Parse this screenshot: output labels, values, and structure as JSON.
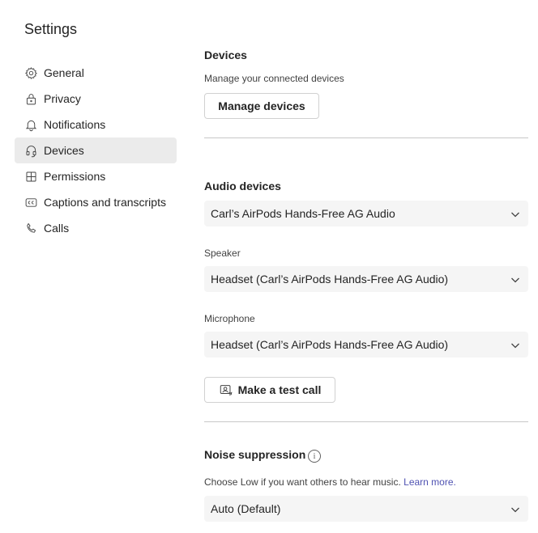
{
  "page": {
    "title": "Settings"
  },
  "sidebar": {
    "items": [
      {
        "label": "General",
        "icon": "gear-icon"
      },
      {
        "label": "Privacy",
        "icon": "lock-icon"
      },
      {
        "label": "Notifications",
        "icon": "bell-icon"
      },
      {
        "label": "Devices",
        "icon": "headset-icon",
        "active": true
      },
      {
        "label": "Permissions",
        "icon": "gift-box-icon"
      },
      {
        "label": "Captions and transcripts",
        "icon": "closed-captions-icon"
      },
      {
        "label": "Calls",
        "icon": "phone-icon"
      }
    ]
  },
  "devices": {
    "heading": "Devices",
    "description": "Manage your connected devices",
    "manage_button": "Manage devices"
  },
  "audio": {
    "heading": "Audio devices",
    "selected_device": "Carl’s AirPods Hands-Free AG Audio",
    "speaker_label": "Speaker",
    "speaker_value": "Headset (Carl’s AirPods Hands-Free AG Audio)",
    "microphone_label": "Microphone",
    "microphone_value": "Headset (Carl’s AirPods Hands-Free AG Audio)",
    "test_call_button": "Make a test call"
  },
  "noise": {
    "heading": "Noise suppression",
    "description": "Choose Low if you want others to hear music.",
    "learn_more": "Learn more.",
    "value": "Auto (Default)"
  }
}
